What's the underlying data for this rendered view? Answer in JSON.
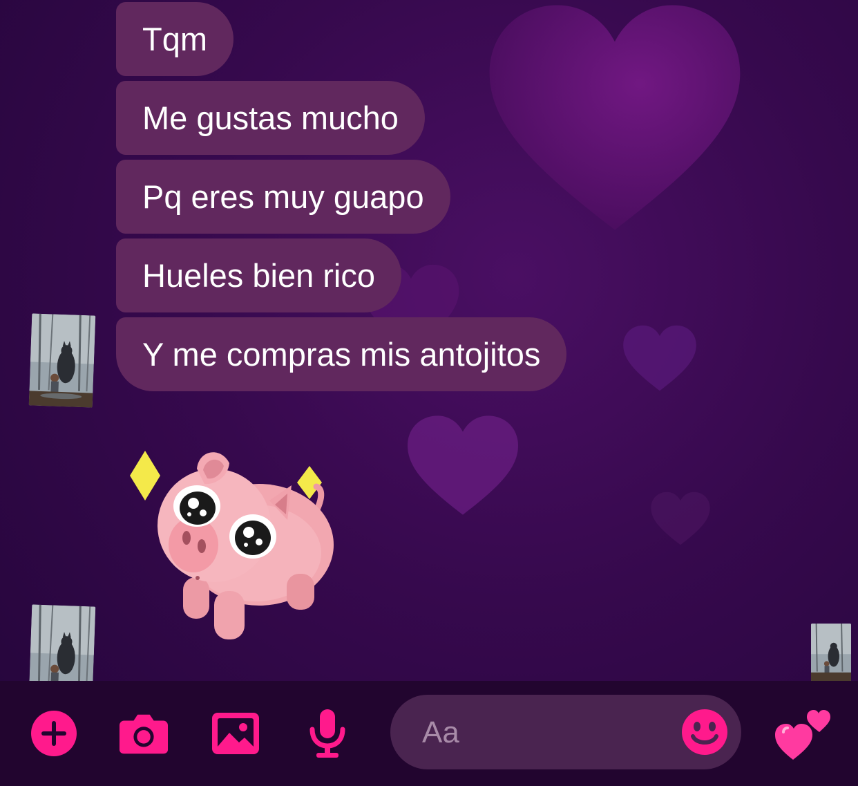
{
  "messages": [
    {
      "text": "Tqm"
    },
    {
      "text": "Me gustas mucho"
    },
    {
      "text": "Pq eres muy guapo"
    },
    {
      "text": "Hueles bien rico"
    },
    {
      "text": "Y me compras mis antojitos"
    }
  ],
  "sticker": {
    "icon": "pig-sticker"
  },
  "composer": {
    "placeholder": "Aa",
    "icons": [
      "add-icon",
      "camera-icon",
      "gallery-icon",
      "microphone-icon",
      "emoji-icon",
      "two-hearts-icon"
    ]
  },
  "colors": {
    "accent": "#ff1a8c",
    "bubble": "#61285e",
    "background": "#36094d",
    "composer_bar": "#22052f",
    "input_pill": "#4a2450"
  }
}
